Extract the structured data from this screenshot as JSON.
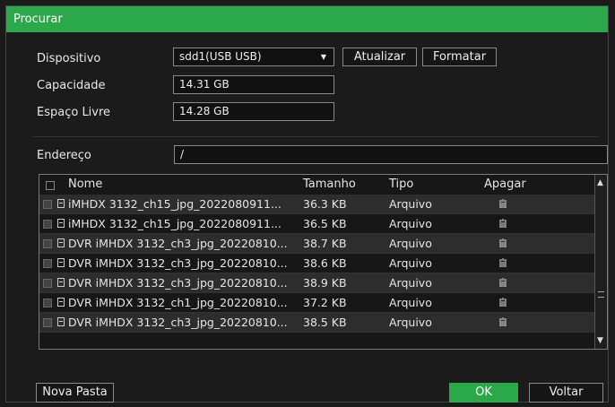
{
  "window": {
    "title": "Procurar"
  },
  "device": {
    "label": "Dispositivo",
    "value": "sdd1(USB USB)",
    "refresh_label": "Atualizar",
    "format_label": "Formatar"
  },
  "capacity": {
    "label": "Capacidade",
    "value": "14.31 GB"
  },
  "free_space": {
    "label": "Espaço Livre",
    "value": "14.28 GB"
  },
  "address": {
    "label": "Endereço",
    "value": "/"
  },
  "table": {
    "headers": {
      "name": "Nome",
      "size": "Tamanho",
      "type": "Tipo",
      "delete": "Apagar"
    },
    "rows": [
      {
        "name": "iMHDX 3132_ch15_jpg_2022080911...",
        "size": "36.3 KB",
        "type": "Arquivo"
      },
      {
        "name": "iMHDX 3132_ch15_jpg_2022080911...",
        "size": "36.5 KB",
        "type": "Arquivo"
      },
      {
        "name": "DVR iMHDX 3132_ch3_jpg_20220810...",
        "size": "38.7 KB",
        "type": "Arquivo"
      },
      {
        "name": "DVR iMHDX 3132_ch3_jpg_20220810...",
        "size": "38.6 KB",
        "type": "Arquivo"
      },
      {
        "name": "DVR iMHDX 3132_ch3_jpg_20220810...",
        "size": "38.9 KB",
        "type": "Arquivo"
      },
      {
        "name": "DVR iMHDX 3132_ch1_jpg_20220810...",
        "size": "37.2 KB",
        "type": "Arquivo"
      },
      {
        "name": "DVR iMHDX 3132_ch3_jpg_20220810...",
        "size": "38.5 KB",
        "type": "Arquivo"
      }
    ]
  },
  "footer": {
    "new_folder_label": "Nova Pasta",
    "ok_label": "OK",
    "back_label": "Voltar"
  },
  "colors": {
    "accent": "#2ba84a"
  }
}
